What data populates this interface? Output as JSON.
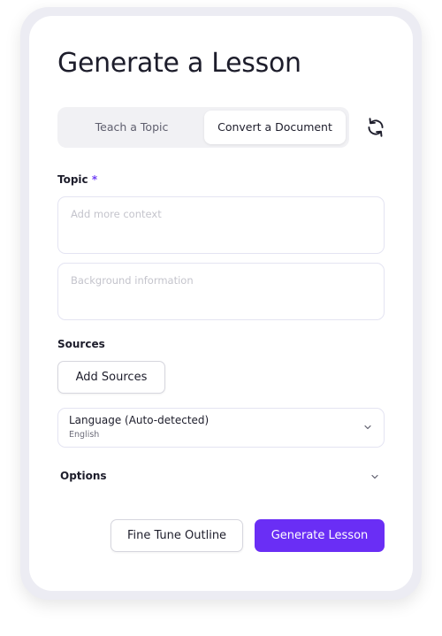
{
  "page": {
    "title": "Generate a Lesson"
  },
  "tabs": [
    {
      "label": "Teach a Topic",
      "selected": false
    },
    {
      "label": "Convert a Document",
      "selected": true
    }
  ],
  "topic": {
    "label": "Topic",
    "required_marker": "*",
    "context_placeholder": "Add more context",
    "background_placeholder": "Background information"
  },
  "sources": {
    "label": "Sources",
    "add_button": "Add Sources"
  },
  "language": {
    "label": "Language (Auto-detected)",
    "value": "English"
  },
  "options": {
    "label": "Options"
  },
  "actions": {
    "fine_tune": "Fine Tune Outline",
    "generate": "Generate Lesson"
  },
  "icons": {
    "refresh": "refresh-icon",
    "language_chevron": "chevron-down-icon",
    "options_chevron": "chevron-down-icon"
  },
  "colors": {
    "accent": "#6a2ef5",
    "required": "#6f3ff5",
    "text": "#1d1d2b",
    "placeholder": "#c4c4cc"
  }
}
